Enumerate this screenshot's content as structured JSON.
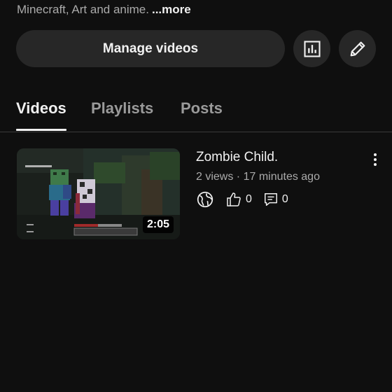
{
  "channel": {
    "description": "Minecraft, Art and anime.",
    "more_label": "...more"
  },
  "actions": {
    "manage_videos_label": "Manage videos",
    "analytics_icon": "bar-chart-icon",
    "edit_icon": "pencil-icon"
  },
  "tabs": [
    {
      "label": "Videos",
      "active": true
    },
    {
      "label": "Playlists",
      "active": false
    },
    {
      "label": "Posts",
      "active": false
    }
  ],
  "videos": [
    {
      "title": "Zombie Child.",
      "meta": "2 views · 17 minutes ago",
      "duration": "2:05",
      "visibility_icon": "globe-icon",
      "likes": "0",
      "comments": "0"
    }
  ],
  "colors": {
    "background": "#0f0f0f",
    "button_bg": "#272727",
    "text_primary": "#f1f1f1",
    "text_secondary": "#aaaaaa"
  }
}
